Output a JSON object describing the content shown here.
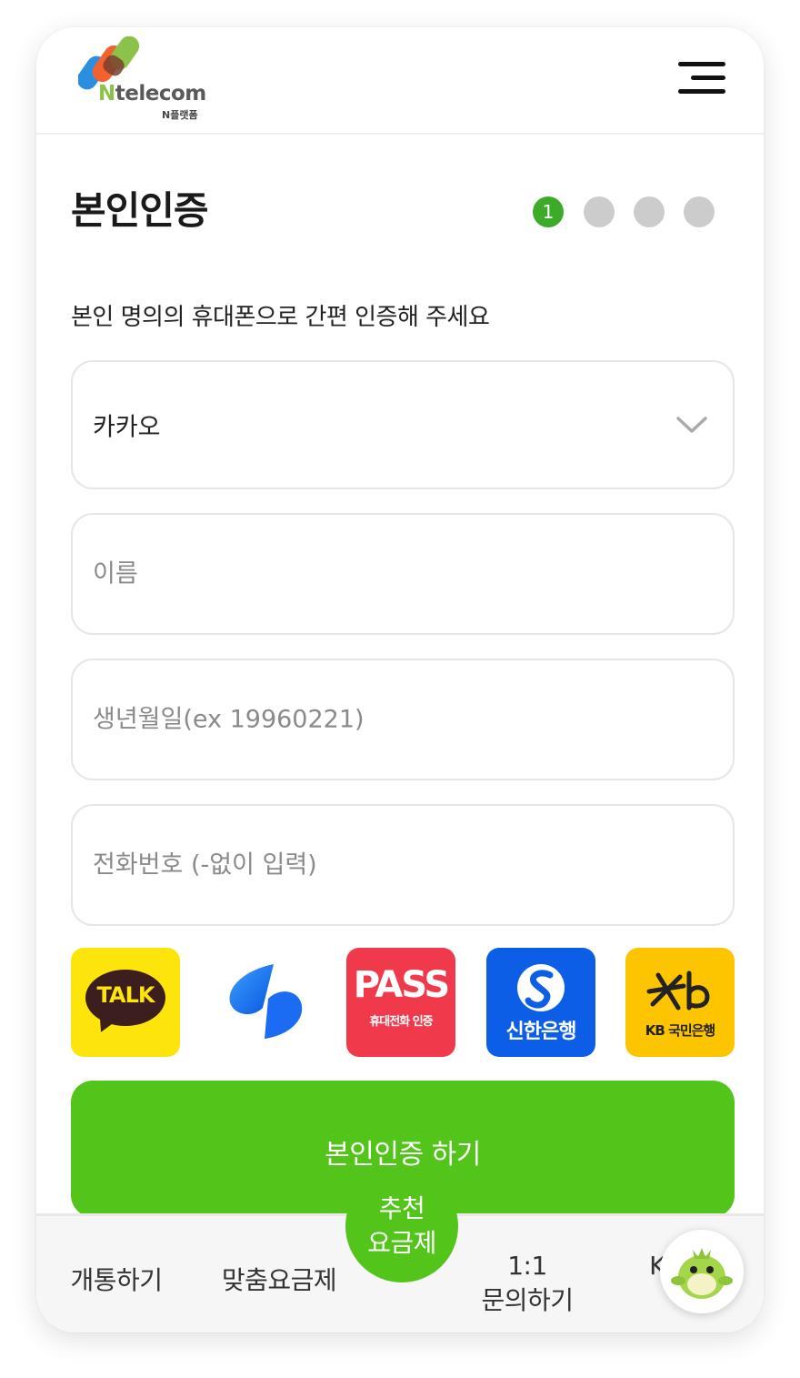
{
  "header": {
    "logo_text_n": "N",
    "logo_text_rest": "telecom",
    "logo_subtext": "N플랫폼"
  },
  "page": {
    "title": "본인인증",
    "subtitle": "본인 명의의 휴대폰으로 간편 인증해 주세요",
    "steps": [
      {
        "label": "1",
        "active": true
      },
      {
        "label": "",
        "active": false
      },
      {
        "label": "",
        "active": false
      },
      {
        "label": "",
        "active": false
      }
    ]
  },
  "form": {
    "provider_select": {
      "value": "카카오"
    },
    "name_field": {
      "placeholder": "이름"
    },
    "birth_field": {
      "placeholder": "생년월일(ex 19960221)"
    },
    "phone_field": {
      "placeholder": "전화번호 (-없이 입력)"
    }
  },
  "auth_apps": {
    "kakao": {
      "label": "TALK"
    },
    "toss": {
      "label": ""
    },
    "pass": {
      "label": "PASS",
      "sublabel": "휴대전화 인증"
    },
    "shinhan": {
      "label": "신한은행"
    },
    "kb": {
      "label": "KB 국민은행"
    }
  },
  "cta": {
    "label": "본인인증 하기"
  },
  "bottom_nav": {
    "item_1": "개통하기",
    "item_2": "맞춤요금제",
    "fab_line_1": "추천",
    "fab_line_2": "요금제",
    "item_4_line_1": "1:1",
    "item_4_line_2": "문의하기",
    "item_5_partial": "K"
  },
  "colors": {
    "accent_green": "#52c41a",
    "step_active": "#3dab2a",
    "step_inactive": "#cccccc",
    "kakao_yellow": "#fde50c",
    "pass_red": "#f0394a",
    "shinhan_blue": "#0c5ee6",
    "kb_yellow": "#fdc400"
  }
}
